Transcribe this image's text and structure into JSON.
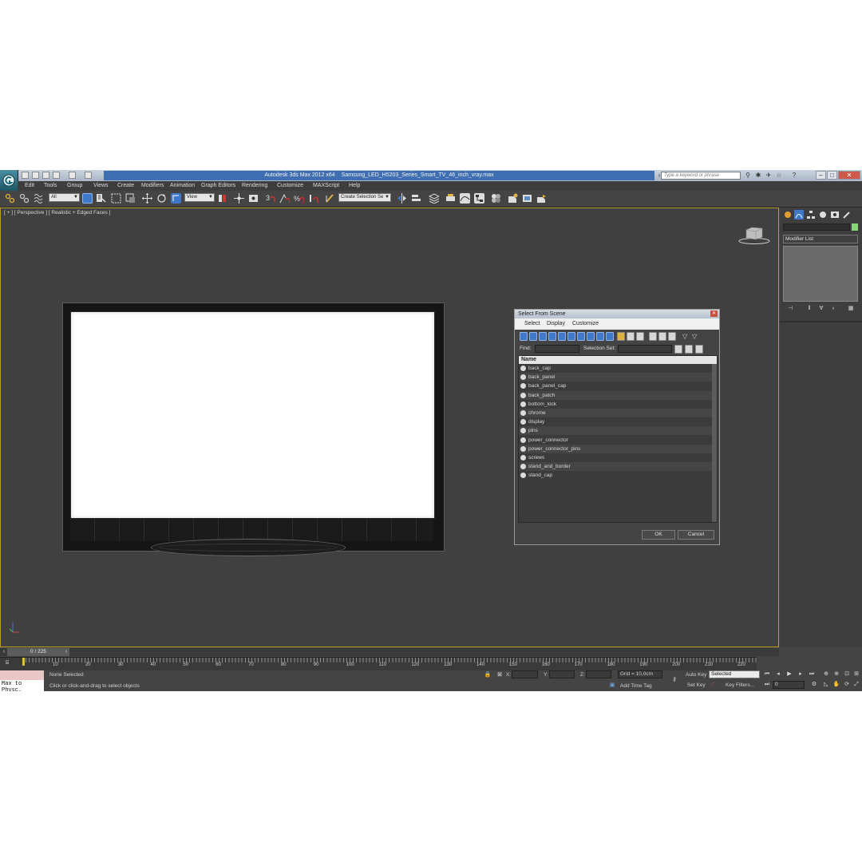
{
  "window": {
    "title_app": "Autodesk 3ds Max  2012 x64",
    "title_file": "Samsung_LED_H5203_Series_Smart_TV_46_inch_vray.max",
    "search_placeholder": "Type a keyword or phrase"
  },
  "menu": [
    "Edit",
    "Tools",
    "Group",
    "Views",
    "Create",
    "Modifiers",
    "Animation",
    "Graph Editors",
    "Rendering",
    "Customize",
    "MAXScript",
    "Help"
  ],
  "toolbar": {
    "selection_filter": "All",
    "reference_coord": "View",
    "named_selection": "Create Selection Se"
  },
  "viewport": {
    "label": "[ + ] [ Perspective ] [ Realistic + Edged Faces ]"
  },
  "dialog": {
    "title": "Select From Scene",
    "menu": [
      "Select",
      "Display",
      "Customize"
    ],
    "find_label": "Find:",
    "selection_set_label": "Selection Set:",
    "column_name": "Name",
    "objects": [
      "back_cap",
      "back_panel",
      "back_panel_cap",
      "back_patch",
      "bottom_lock",
      "chrome",
      "display",
      "pins",
      "power_connector",
      "power_connector_pins",
      "screws",
      "stand_and_border",
      "stand_cap"
    ],
    "ok_label": "OK",
    "cancel_label": "Cancel"
  },
  "command_panel": {
    "modifier_list": "Modifier List",
    "object_color": "#8ad47a"
  },
  "timeline": {
    "frame_display": "0 / 225",
    "ticks": [
      "10",
      "20",
      "30",
      "40",
      "50",
      "60",
      "70",
      "80",
      "90",
      "100",
      "110",
      "120",
      "130",
      "140",
      "150",
      "160",
      "170",
      "180",
      "190",
      "200",
      "210",
      "220"
    ]
  },
  "status": {
    "maxscript_listener": "Max to Physc.",
    "selection_status": "None Selected",
    "prompt": "Click or click-and-drag to select objects",
    "x_label": "X:",
    "y_label": "Y:",
    "z_label": "Z:",
    "grid": "Grid = 10,0cm",
    "add_time_tag": "Add Time Tag",
    "auto_key": "Auto Key",
    "set_key": "Set Key",
    "key_mode": "Selected",
    "key_filters": "Key Filters...",
    "current_frame": "0"
  }
}
